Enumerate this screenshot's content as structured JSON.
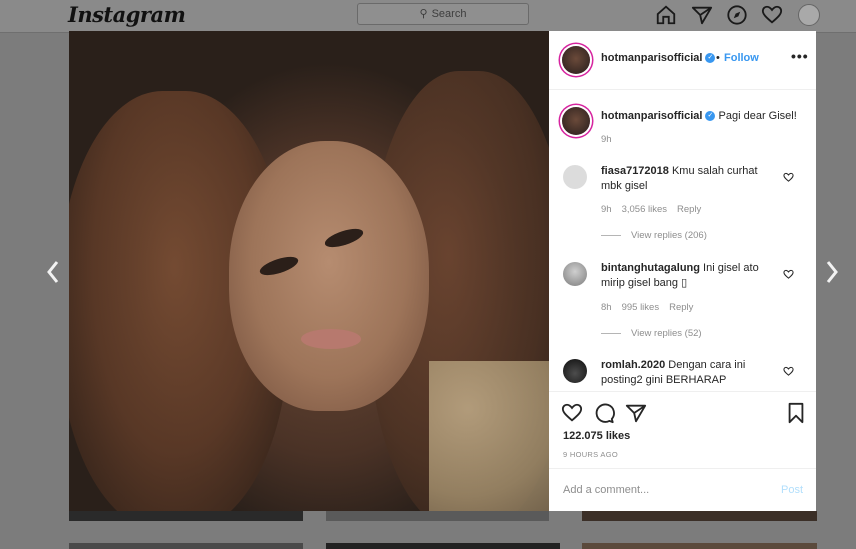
{
  "app": {
    "logo": "Instagram",
    "search_placeholder": "Search"
  },
  "nav_icons": [
    "home-icon",
    "direct-icon",
    "explore-icon",
    "activity-icon",
    "profile-avatar"
  ],
  "post": {
    "author": "hotmanparisofficial",
    "follow_label": "Follow",
    "more_label": "•••",
    "caption_user": "hotmanparisofficial",
    "caption_text": "Pagi dear Gisel!",
    "caption_time": "9h",
    "likes": "122.075 likes",
    "time_ago": "9 HOURS AGO"
  },
  "comments": [
    {
      "user": "fiasa7172018",
      "text": "Kmu salah curhat mbk gisel",
      "time": "9h",
      "likes": "3,056 likes",
      "reply_label": "Reply",
      "view_replies": "View replies (206)"
    },
    {
      "user": "bintanghutagalung",
      "text": "Ini gisel ato mirip gisel bang ▯",
      "time": "8h",
      "likes": "995 likes",
      "reply_label": "Reply",
      "view_replies": "View replies (52)"
    },
    {
      "user": "romlah.2020",
      "text": "Dengan cara ini posting2 gini BERHARAP",
      "time": "",
      "likes": "",
      "reply_label": "",
      "view_replies": ""
    }
  ],
  "composer": {
    "placeholder": "Add a comment...",
    "post_label": "Post"
  },
  "colors": {
    "link_blue": "#3897f0",
    "post_disabled": "#b2dffc",
    "overlay": "#7c7c7c"
  }
}
